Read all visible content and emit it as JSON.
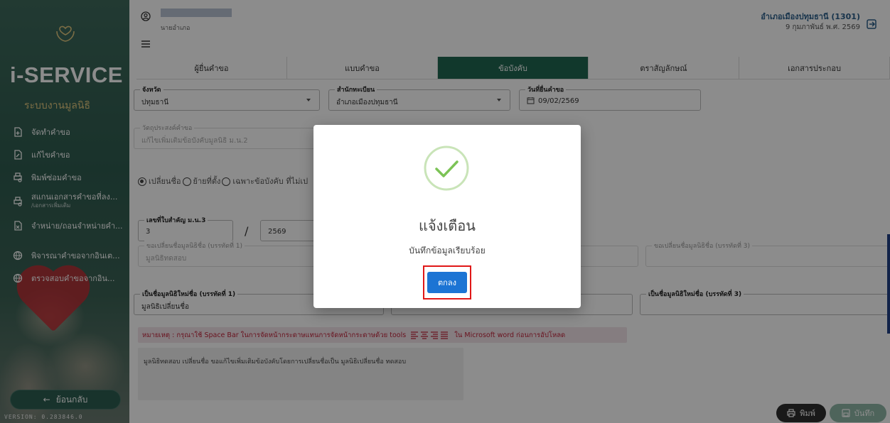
{
  "sidebar": {
    "brand": "i-SERVICE",
    "subbrand": "ระบบงานมูลนิธิ",
    "items": [
      {
        "label": "จัดทำคำขอ",
        "sub": ""
      },
      {
        "label": "แก้ไขคำขอ",
        "sub": ""
      },
      {
        "label": "พิมพ์ซ่อมคำขอ",
        "sub": ""
      },
      {
        "label": "สแกนเอกสารคำขอที่ลง...",
        "sub": "/เอกสารเพิ่มเติม"
      },
      {
        "label": "จำหน่าย/ถอนจำหน่ายคำ...",
        "sub": ""
      },
      {
        "label": "พิจารณาคำขอจากอินเต...",
        "sub": ""
      },
      {
        "label": "ตรวจสอบคำขอจากอิน...",
        "sub": ""
      }
    ],
    "back_label": "ย้อนกลับ",
    "back_arrow": "←",
    "version": "VERSION: 0.283846.0"
  },
  "header": {
    "user_role": "นายอำเภอ",
    "office_name": "อำเภอเมืองปทุมธานี (1301)",
    "office_date": "9 กุมภาพันธ์ พ.ศ. 2569"
  },
  "tabs": [
    {
      "label": "ผู้ยื่นคำขอ",
      "active": false
    },
    {
      "label": "แบบคำขอ",
      "active": false
    },
    {
      "label": "ข้อบังคับ",
      "active": true
    },
    {
      "label": "ตราสัญลักษณ์",
      "active": false
    },
    {
      "label": "เอกสารประกอบ",
      "active": false
    }
  ],
  "form": {
    "province": {
      "label": "จังหวัด",
      "value": "ปทุมธานี"
    },
    "registry": {
      "label": "สำนักทะเบียน",
      "value": "อำเภอเมืองปทุมธานี"
    },
    "submit_date": {
      "label": "วันที่ยื่นคำขอ",
      "value": "09/02/2569"
    },
    "purpose": {
      "label": "วัตถุประสงค์คำขอ",
      "value": "แก้ไขเพิ่มเติมข้อบังคับมูลนิธิ ม.น.2"
    },
    "radios": [
      {
        "label": "เปลี่ยนชื่อ",
        "checked": true
      },
      {
        "label": "ย้ายที่ตั้ง",
        "checked": false
      },
      {
        "label": "เฉพาะข้อบังคับ ที่ไม่เป",
        "checked": false
      }
    ],
    "reg_no": {
      "label": "เลขที่ใบสำคัญ ม.น.3",
      "value": "3",
      "year": "2569",
      "slash": "/"
    },
    "old_name_1": {
      "label": "ขอเปลี่ยนชื่อมูลนิธิชื่อ (บรรทัดที่ 1)",
      "value": "มูลนิธิทดสอบ"
    },
    "old_name_3": {
      "label": "ขอเปลี่ยนชื่อมูลนิธิชื่อ (บรรทัดที่ 3)",
      "value": ""
    },
    "new_name_1": {
      "label": "เป็นชื่อมูลนิธิใหม่ชื่อ (บรรทัดที่ 1)",
      "value": "มูลนิธิเปลี่ยนชื่อ"
    },
    "new_name_3": {
      "label": "เป็นชื่อมูลนิธิใหม่ชื่อ (บรรทัดที่ 3)",
      "value": ""
    },
    "note": "หมายเหตุ : กรุณาใช้ Space Bar ในการจัดหน้ากระดาษแทนการจัดหน้ากระดาษด้วย tools",
    "note_tail": "ใน Microsoft word ก่อนการอัปโหลด",
    "summary": "มูลนิธิทดสอบ เปลี่ยนชื่อ ขอแก้ไขเพิ่มเติมข้อบังคับโดยการเปลี่ยนชื่อเป็น มูลนิธิเปลี่ยนชื่อ ทดสอบ"
  },
  "actions": {
    "print_label": "พิมพ์",
    "save_label": "บันทึก"
  },
  "modal": {
    "title": "แจ้งเตือน",
    "message": "บันทึกข้อมูลเรียบร้อย",
    "ok_label": "ตกลง"
  },
  "colors": {
    "accent": "#1f6651",
    "ok_button": "#1c74d4",
    "highlight": "#e01818",
    "note_text": "#c0243a"
  }
}
